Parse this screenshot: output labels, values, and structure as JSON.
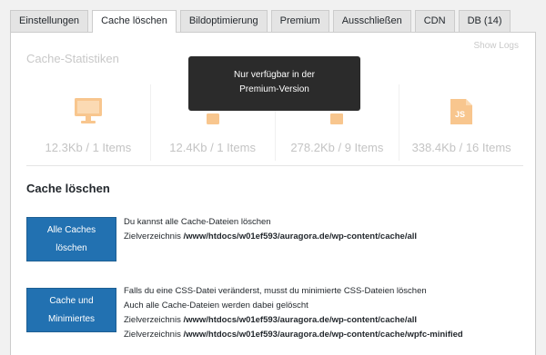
{
  "tabs": [
    {
      "label": "Einstellungen",
      "active": false
    },
    {
      "label": "Cache löschen",
      "active": true
    },
    {
      "label": "Bildoptimierung",
      "active": false
    },
    {
      "label": "Premium",
      "active": false
    },
    {
      "label": "Ausschließen",
      "active": false
    },
    {
      "label": "CDN",
      "active": false
    },
    {
      "label": "DB (14)",
      "active": false
    }
  ],
  "show_logs": "Show Logs",
  "stats": {
    "title": "Cache-Statistiken",
    "items": [
      {
        "icon": "desktop-icon",
        "value": "12.3Kb / 1 Items"
      },
      {
        "icon": "mobile-icon",
        "value": "12.4Kb / 1 Items"
      },
      {
        "icon": "css-file-icon",
        "value": "278.2Kb / 9 Items"
      },
      {
        "icon": "js-file-icon",
        "value": "338.4Kb / 16 Items"
      }
    ],
    "icon_color": "#f8c68e"
  },
  "tooltip": {
    "line1": "Nur verfügbar in der",
    "line2": "Premium-Version"
  },
  "clear_section": {
    "title": "Cache löschen",
    "all_button": {
      "line1": "Alle Caches",
      "line2": "löschen"
    },
    "all_desc": "Du kannst alle Cache-Dateien löschen",
    "all_dir_label": "Zielverzeichnis",
    "all_dir_path": "/www/htdocs/w01ef593/auragora.de/wp-content/cache/all",
    "min_button": {
      "line1": "Cache und",
      "line2": "Minimiertes"
    },
    "min_desc1": "Falls du eine CSS-Datei veränderst, musst du minimierte CSS-Dateien löschen",
    "min_desc2": "Auch alle Cache-Dateien werden dabei gelöscht",
    "min_dir1_label": "Zielverzeichnis",
    "min_dir1_path": "/www/htdocs/w01ef593/auragora.de/wp-content/cache/all",
    "min_dir2_label": "Zielverzeichnis",
    "min_dir2_path": "/www/htdocs/w01ef593/auragora.de/wp-content/cache/wpfc-minified"
  },
  "colors": {
    "button": "#2271b1",
    "tooltip": "#2b2b2b"
  }
}
